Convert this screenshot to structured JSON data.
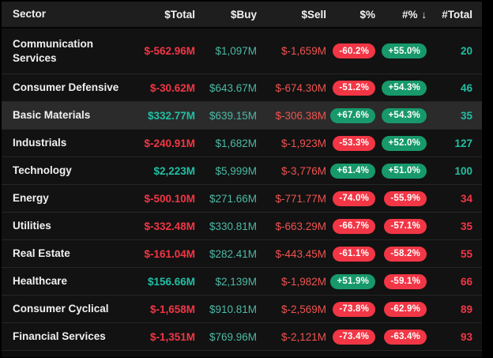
{
  "header": {
    "columns": [
      {
        "label": "Sector"
      },
      {
        "label": "$Total"
      },
      {
        "label": "$Buy"
      },
      {
        "label": "$Sell"
      },
      {
        "label": "$%"
      },
      {
        "label": "#%",
        "sorted": "desc"
      },
      {
        "label": "#Total"
      }
    ],
    "sort_arrow": "↓"
  },
  "rows": [
    {
      "sector": "Communication Services",
      "total": "$-562.96M",
      "buy": "$1,097M",
      "sell": "$-1,659M",
      "dollar_pct": "-60.2%",
      "count_pct": "+55.0%",
      "count_total": "20",
      "count_total_sign": "pos",
      "highlighted": false
    },
    {
      "sector": "Consumer Defensive",
      "total": "$-30.62M",
      "buy": "$643.67M",
      "sell": "$-674.30M",
      "dollar_pct": "-51.2%",
      "count_pct": "+54.3%",
      "count_total": "46",
      "count_total_sign": "pos",
      "highlighted": false
    },
    {
      "sector": "Basic Materials",
      "total": "$332.77M",
      "buy": "$639.15M",
      "sell": "$-306.38M",
      "dollar_pct": "+67.6%",
      "count_pct": "+54.3%",
      "count_total": "35",
      "count_total_sign": "pos",
      "highlighted": true
    },
    {
      "sector": "Industrials",
      "total": "$-240.91M",
      "buy": "$1,682M",
      "sell": "$-1,923M",
      "dollar_pct": "-53.3%",
      "count_pct": "+52.0%",
      "count_total": "127",
      "count_total_sign": "pos",
      "highlighted": false
    },
    {
      "sector": "Technology",
      "total": "$2,223M",
      "buy": "$5,999M",
      "sell": "$-3,776M",
      "dollar_pct": "+61.4%",
      "count_pct": "+51.0%",
      "count_total": "100",
      "count_total_sign": "pos",
      "highlighted": false
    },
    {
      "sector": "Energy",
      "total": "$-500.10M",
      "buy": "$271.66M",
      "sell": "$-771.77M",
      "dollar_pct": "-74.0%",
      "count_pct": "-55.9%",
      "count_total": "34",
      "count_total_sign": "neg",
      "highlighted": false
    },
    {
      "sector": "Utilities",
      "total": "$-332.48M",
      "buy": "$330.81M",
      "sell": "$-663.29M",
      "dollar_pct": "-66.7%",
      "count_pct": "-57.1%",
      "count_total": "35",
      "count_total_sign": "neg",
      "highlighted": false
    },
    {
      "sector": "Real Estate",
      "total": "$-161.04M",
      "buy": "$282.41M",
      "sell": "$-443.45M",
      "dollar_pct": "-61.1%",
      "count_pct": "-58.2%",
      "count_total": "55",
      "count_total_sign": "neg",
      "highlighted": false
    },
    {
      "sector": "Healthcare",
      "total": "$156.66M",
      "buy": "$2,139M",
      "sell": "$-1,982M",
      "dollar_pct": "+51.9%",
      "count_pct": "-59.1%",
      "count_total": "66",
      "count_total_sign": "neg",
      "highlighted": false
    },
    {
      "sector": "Consumer Cyclical",
      "total": "$-1,658M",
      "buy": "$910.81M",
      "sell": "$-2,569M",
      "dollar_pct": "-73.8%",
      "count_pct": "-62.9%",
      "count_total": "89",
      "count_total_sign": "neg",
      "highlighted": false
    },
    {
      "sector": "Financial Services",
      "total": "$-1,351M",
      "buy": "$769.96M",
      "sell": "$-2,121M",
      "dollar_pct": "-73.4%",
      "count_pct": "-63.4%",
      "count_total": "93",
      "count_total_sign": "neg",
      "highlighted": false
    }
  ],
  "colors": {
    "background": "#000000",
    "header_background": "#1e1e1e",
    "row_background": "#121212",
    "row_highlight": "#2b2b2b",
    "separator": "#262626",
    "text_primary": "#f2f2f2",
    "green_bold": "#21bfa4",
    "green_regular": "#4cb9a6",
    "red_bold": "#f23645",
    "red_regular": "#ef5350",
    "badge_green": "#17996b",
    "badge_red": "#f23645"
  }
}
